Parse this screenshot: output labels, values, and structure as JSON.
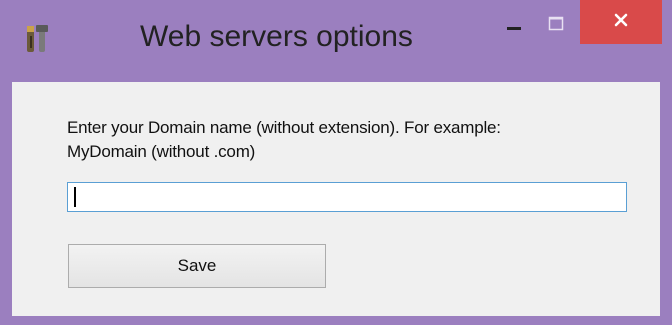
{
  "window": {
    "title": "Web servers options",
    "app_icon": "tools-icon",
    "controls": {
      "minimize_icon": "minimize-icon",
      "maximize_icon": "maximize-icon",
      "close_icon": "close-icon",
      "close_color": "#d94a4a"
    },
    "frame_color": "#9b7fbf"
  },
  "form": {
    "prompt_line1": "Enter your Domain name (without extension). For example:",
    "prompt_line2": "MyDomain (without .com)",
    "domain_value": "",
    "input_border_color": "#5a9fd4",
    "save_label": "Save"
  }
}
